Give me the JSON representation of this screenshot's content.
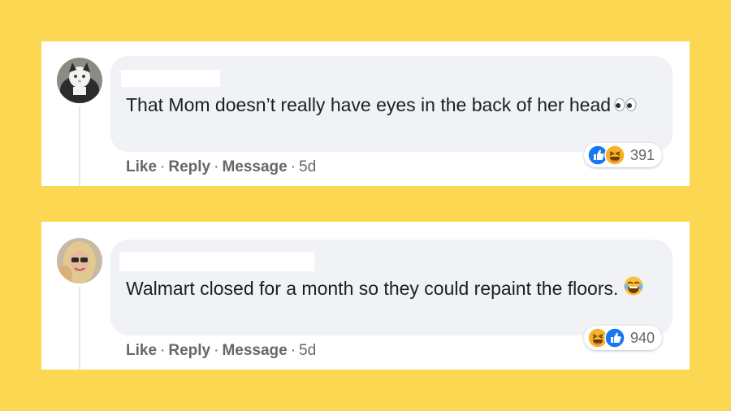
{
  "comments": [
    {
      "text": "That Mom doesn’t really have eyes in the back of her head",
      "actions": {
        "like": "Like",
        "reply": "Reply",
        "message": "Message",
        "time": "5d"
      },
      "reactions": {
        "count": "391",
        "icons": [
          "like-icon",
          "haha-icon"
        ]
      },
      "text_emoji": "eyes-icon"
    },
    {
      "text": "Walmart closed for a month so they could repaint the floors.",
      "actions": {
        "like": "Like",
        "reply": "Reply",
        "message": "Message",
        "time": "5d"
      },
      "reactions": {
        "count": "940",
        "icons": [
          "haha-icon",
          "like-icon"
        ]
      },
      "text_emoji": "laughing-tears-icon"
    }
  ],
  "separator": "·",
  "colors": {
    "background": "#fcd751",
    "bubble": "#f0f2f5",
    "secondary_text": "#65676b",
    "like_blue": "#1877f2",
    "haha_yellow": "#f7b125"
  }
}
